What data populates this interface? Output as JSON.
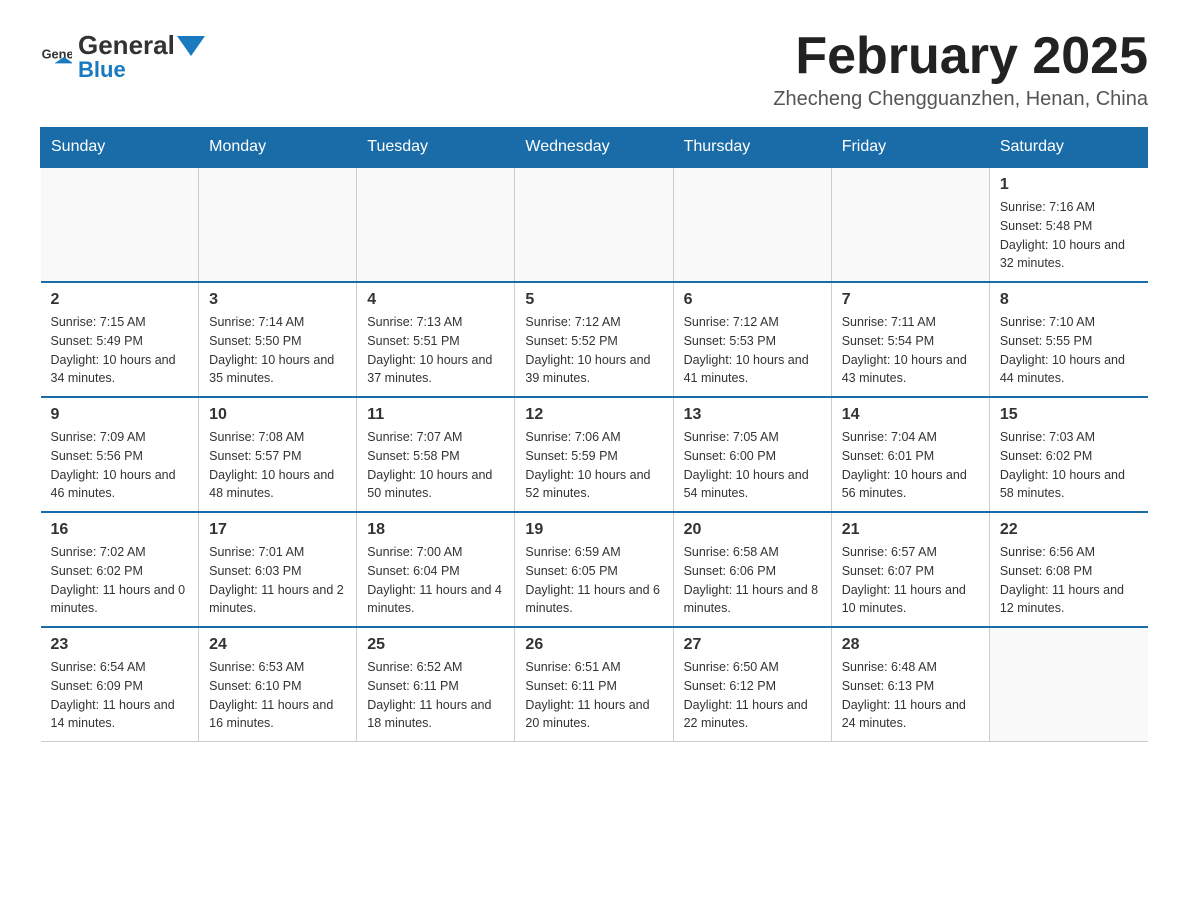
{
  "header": {
    "logo_text_general": "General",
    "logo_text_blue": "Blue",
    "month_title": "February 2025",
    "location": "Zhecheng Chengguanzhen, Henan, China"
  },
  "days_of_week": [
    "Sunday",
    "Monday",
    "Tuesday",
    "Wednesday",
    "Thursday",
    "Friday",
    "Saturday"
  ],
  "weeks": [
    [
      {
        "day": "",
        "info": ""
      },
      {
        "day": "",
        "info": ""
      },
      {
        "day": "",
        "info": ""
      },
      {
        "day": "",
        "info": ""
      },
      {
        "day": "",
        "info": ""
      },
      {
        "day": "",
        "info": ""
      },
      {
        "day": "1",
        "info": "Sunrise: 7:16 AM\nSunset: 5:48 PM\nDaylight: 10 hours and 32 minutes."
      }
    ],
    [
      {
        "day": "2",
        "info": "Sunrise: 7:15 AM\nSunset: 5:49 PM\nDaylight: 10 hours and 34 minutes."
      },
      {
        "day": "3",
        "info": "Sunrise: 7:14 AM\nSunset: 5:50 PM\nDaylight: 10 hours and 35 minutes."
      },
      {
        "day": "4",
        "info": "Sunrise: 7:13 AM\nSunset: 5:51 PM\nDaylight: 10 hours and 37 minutes."
      },
      {
        "day": "5",
        "info": "Sunrise: 7:12 AM\nSunset: 5:52 PM\nDaylight: 10 hours and 39 minutes."
      },
      {
        "day": "6",
        "info": "Sunrise: 7:12 AM\nSunset: 5:53 PM\nDaylight: 10 hours and 41 minutes."
      },
      {
        "day": "7",
        "info": "Sunrise: 7:11 AM\nSunset: 5:54 PM\nDaylight: 10 hours and 43 minutes."
      },
      {
        "day": "8",
        "info": "Sunrise: 7:10 AM\nSunset: 5:55 PM\nDaylight: 10 hours and 44 minutes."
      }
    ],
    [
      {
        "day": "9",
        "info": "Sunrise: 7:09 AM\nSunset: 5:56 PM\nDaylight: 10 hours and 46 minutes."
      },
      {
        "day": "10",
        "info": "Sunrise: 7:08 AM\nSunset: 5:57 PM\nDaylight: 10 hours and 48 minutes."
      },
      {
        "day": "11",
        "info": "Sunrise: 7:07 AM\nSunset: 5:58 PM\nDaylight: 10 hours and 50 minutes."
      },
      {
        "day": "12",
        "info": "Sunrise: 7:06 AM\nSunset: 5:59 PM\nDaylight: 10 hours and 52 minutes."
      },
      {
        "day": "13",
        "info": "Sunrise: 7:05 AM\nSunset: 6:00 PM\nDaylight: 10 hours and 54 minutes."
      },
      {
        "day": "14",
        "info": "Sunrise: 7:04 AM\nSunset: 6:01 PM\nDaylight: 10 hours and 56 minutes."
      },
      {
        "day": "15",
        "info": "Sunrise: 7:03 AM\nSunset: 6:02 PM\nDaylight: 10 hours and 58 minutes."
      }
    ],
    [
      {
        "day": "16",
        "info": "Sunrise: 7:02 AM\nSunset: 6:02 PM\nDaylight: 11 hours and 0 minutes."
      },
      {
        "day": "17",
        "info": "Sunrise: 7:01 AM\nSunset: 6:03 PM\nDaylight: 11 hours and 2 minutes."
      },
      {
        "day": "18",
        "info": "Sunrise: 7:00 AM\nSunset: 6:04 PM\nDaylight: 11 hours and 4 minutes."
      },
      {
        "day": "19",
        "info": "Sunrise: 6:59 AM\nSunset: 6:05 PM\nDaylight: 11 hours and 6 minutes."
      },
      {
        "day": "20",
        "info": "Sunrise: 6:58 AM\nSunset: 6:06 PM\nDaylight: 11 hours and 8 minutes."
      },
      {
        "day": "21",
        "info": "Sunrise: 6:57 AM\nSunset: 6:07 PM\nDaylight: 11 hours and 10 minutes."
      },
      {
        "day": "22",
        "info": "Sunrise: 6:56 AM\nSunset: 6:08 PM\nDaylight: 11 hours and 12 minutes."
      }
    ],
    [
      {
        "day": "23",
        "info": "Sunrise: 6:54 AM\nSunset: 6:09 PM\nDaylight: 11 hours and 14 minutes."
      },
      {
        "day": "24",
        "info": "Sunrise: 6:53 AM\nSunset: 6:10 PM\nDaylight: 11 hours and 16 minutes."
      },
      {
        "day": "25",
        "info": "Sunrise: 6:52 AM\nSunset: 6:11 PM\nDaylight: 11 hours and 18 minutes."
      },
      {
        "day": "26",
        "info": "Sunrise: 6:51 AM\nSunset: 6:11 PM\nDaylight: 11 hours and 20 minutes."
      },
      {
        "day": "27",
        "info": "Sunrise: 6:50 AM\nSunset: 6:12 PM\nDaylight: 11 hours and 22 minutes."
      },
      {
        "day": "28",
        "info": "Sunrise: 6:48 AM\nSunset: 6:13 PM\nDaylight: 11 hours and 24 minutes."
      },
      {
        "day": "",
        "info": ""
      }
    ]
  ]
}
